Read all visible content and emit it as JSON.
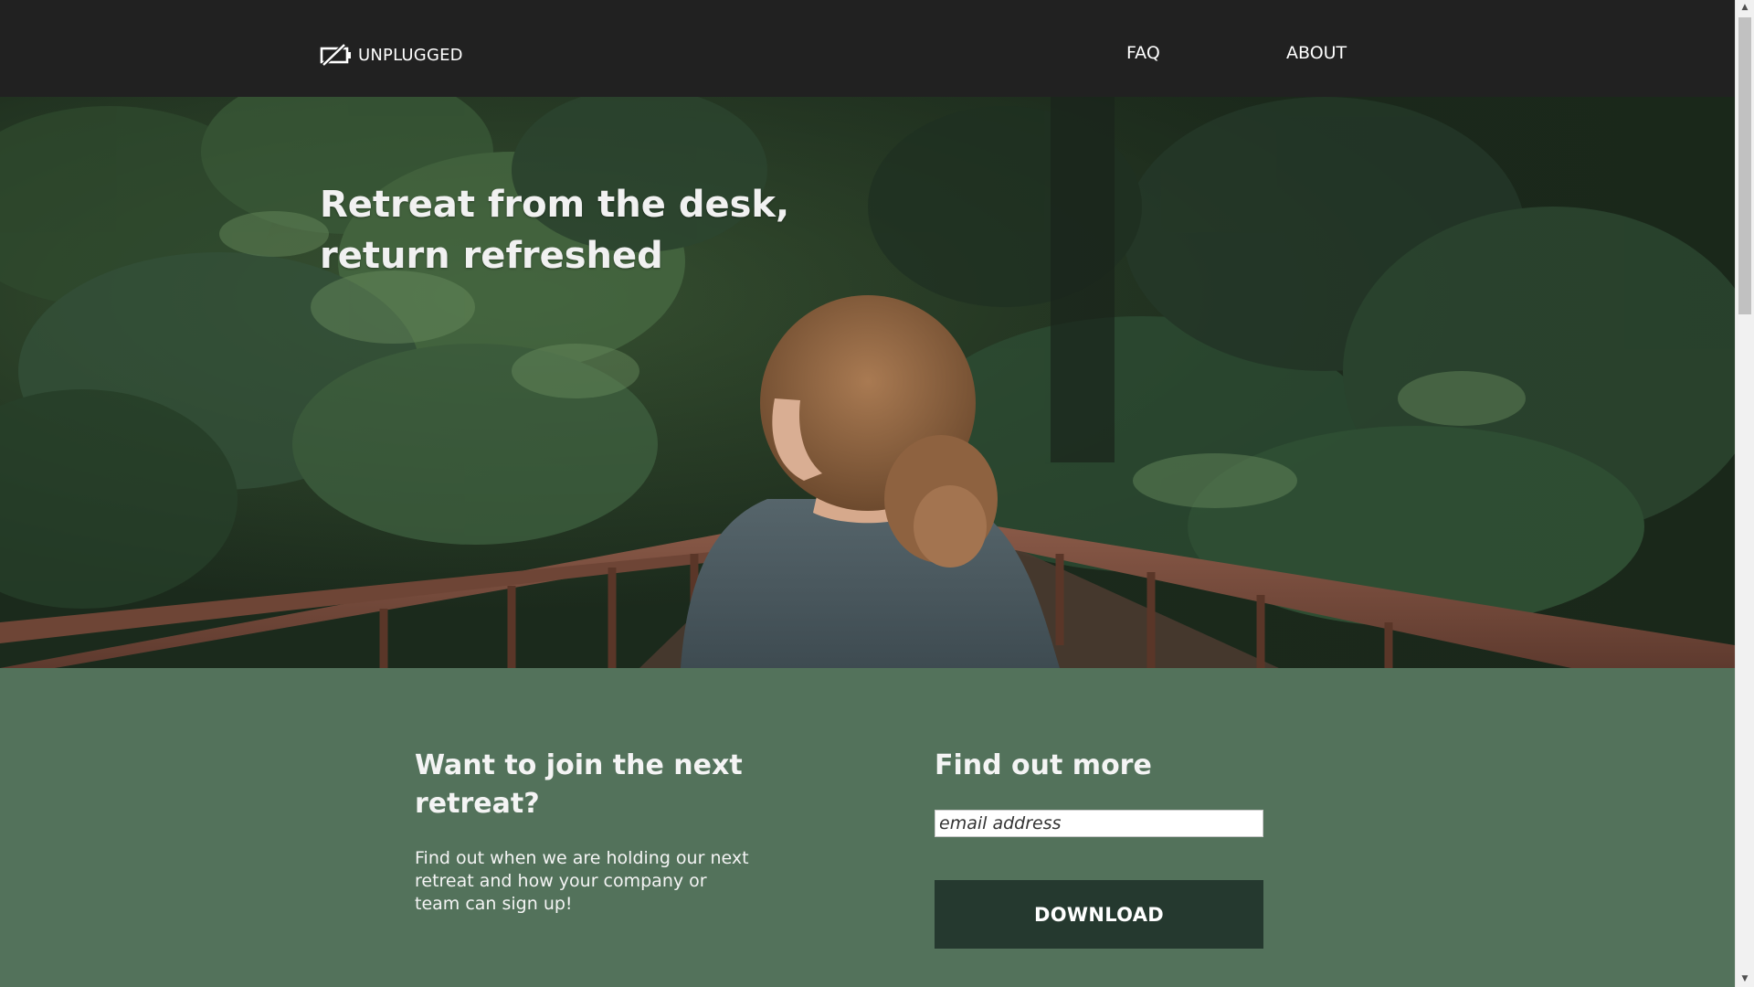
{
  "header": {
    "logo_text": "UNPLUGGED",
    "nav": [
      {
        "label": "FAQ"
      },
      {
        "label": "ABOUT"
      }
    ]
  },
  "hero": {
    "title": "Retreat from the desk, return refreshed",
    "image": "woman-on-forest-bridge"
  },
  "join": {
    "heading": "Want to join the next retreat?",
    "text": "Find out when we are holding our next retreat and how your company or team can sign up!"
  },
  "signup": {
    "heading": "Find out more",
    "email_placeholder": "email address",
    "email_value": "",
    "button_label": "DOWNLOAD"
  },
  "colors": {
    "nav_bg": "#212121",
    "section_bg": "#53725b",
    "button_bg": "#25392f",
    "text_light": "#f4f4f4"
  },
  "icons": {
    "logo": "unplugged-logo-icon",
    "scroll_up": "arrow-up-icon",
    "scroll_down": "arrow-down-icon"
  },
  "scroll": {
    "position": 0
  }
}
